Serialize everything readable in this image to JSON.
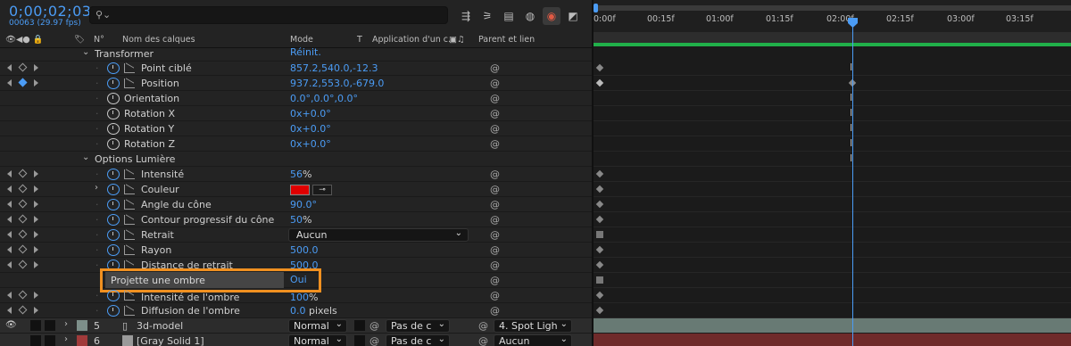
{
  "topbar": {
    "timecode": "0;00;02;03",
    "fps": "00063 (29.97 fps)",
    "search_placeholder": "",
    "tools": [
      "composition-flowchart-icon",
      "draft-3d-icon",
      "frame-blending-icon",
      "motion-blur-icon",
      "hide-shy-icon",
      "graph-editor-icon"
    ]
  },
  "header": {
    "num": "N°",
    "layer_name": "Nom des calques",
    "mode": "Mode",
    "t": "T",
    "track": "Application d'un c...",
    "parent": "Parent et lien"
  },
  "properties": [
    {
      "label": "Transformer",
      "value": "Réinit.",
      "type": "group"
    },
    {
      "label": "Point ciblé",
      "value": "857.2,540.0,-12.3",
      "type": "prop"
    },
    {
      "label": "Position",
      "value": "937.2,553.0,-679.0",
      "type": "prop"
    },
    {
      "label": "Orientation",
      "value": "0.0°,0.0°,0.0°",
      "type": "prop"
    },
    {
      "label": "Rotation X",
      "value": "0x+0.0°",
      "type": "prop"
    },
    {
      "label": "Rotation Y",
      "value": "0x+0.0°",
      "type": "prop"
    },
    {
      "label": "Rotation Z",
      "value": "0x+0.0°",
      "type": "prop"
    },
    {
      "label": "Options Lumière",
      "value": "",
      "type": "group"
    },
    {
      "label": "Intensité",
      "value": "56",
      "unit": "%",
      "type": "prop"
    },
    {
      "label": "Couleur",
      "value": "",
      "type": "color",
      "color": "#e00000"
    },
    {
      "label": "Angle du cône",
      "value": "90.0°",
      "type": "prop"
    },
    {
      "label": "Contour progressif du cône",
      "value": "50",
      "unit": "%",
      "type": "prop"
    },
    {
      "label": "Retrait",
      "value": "Aucun",
      "type": "dropdown"
    },
    {
      "label": "Rayon",
      "value": "500.0",
      "type": "prop"
    },
    {
      "label": "Distance de retrait",
      "value": "500.0",
      "type": "prop"
    },
    {
      "label": "Projette une ombre",
      "value": "Oui",
      "type": "highlight"
    },
    {
      "label": "Intensité de l'ombre",
      "value": "100",
      "unit": "%",
      "type": "prop"
    },
    {
      "label": "Diffusion de l'ombre",
      "value": "0.0",
      "unit": " pixels",
      "type": "prop"
    }
  ],
  "layers": [
    {
      "num": "5",
      "name": "3d-model",
      "mode": "Normal",
      "track": "Pas de c",
      "parent": "4. Spot Ligh",
      "label_color": "#7d8f8a"
    },
    {
      "num": "6",
      "name": "[Gray Solid 1]",
      "mode": "Normal",
      "track": "Pas de c",
      "parent": "Aucun",
      "label_color": "#a03a3a"
    }
  ],
  "timeline": {
    "ticks": [
      "0:00f",
      "00:15f",
      "01:00f",
      "01:15f",
      "02:00f",
      "02:15f",
      "03:00f",
      "03:15f"
    ]
  },
  "colors": {
    "accent": "#4b9cf5",
    "highlight": "#f09020",
    "workarea": "#21b04a"
  }
}
